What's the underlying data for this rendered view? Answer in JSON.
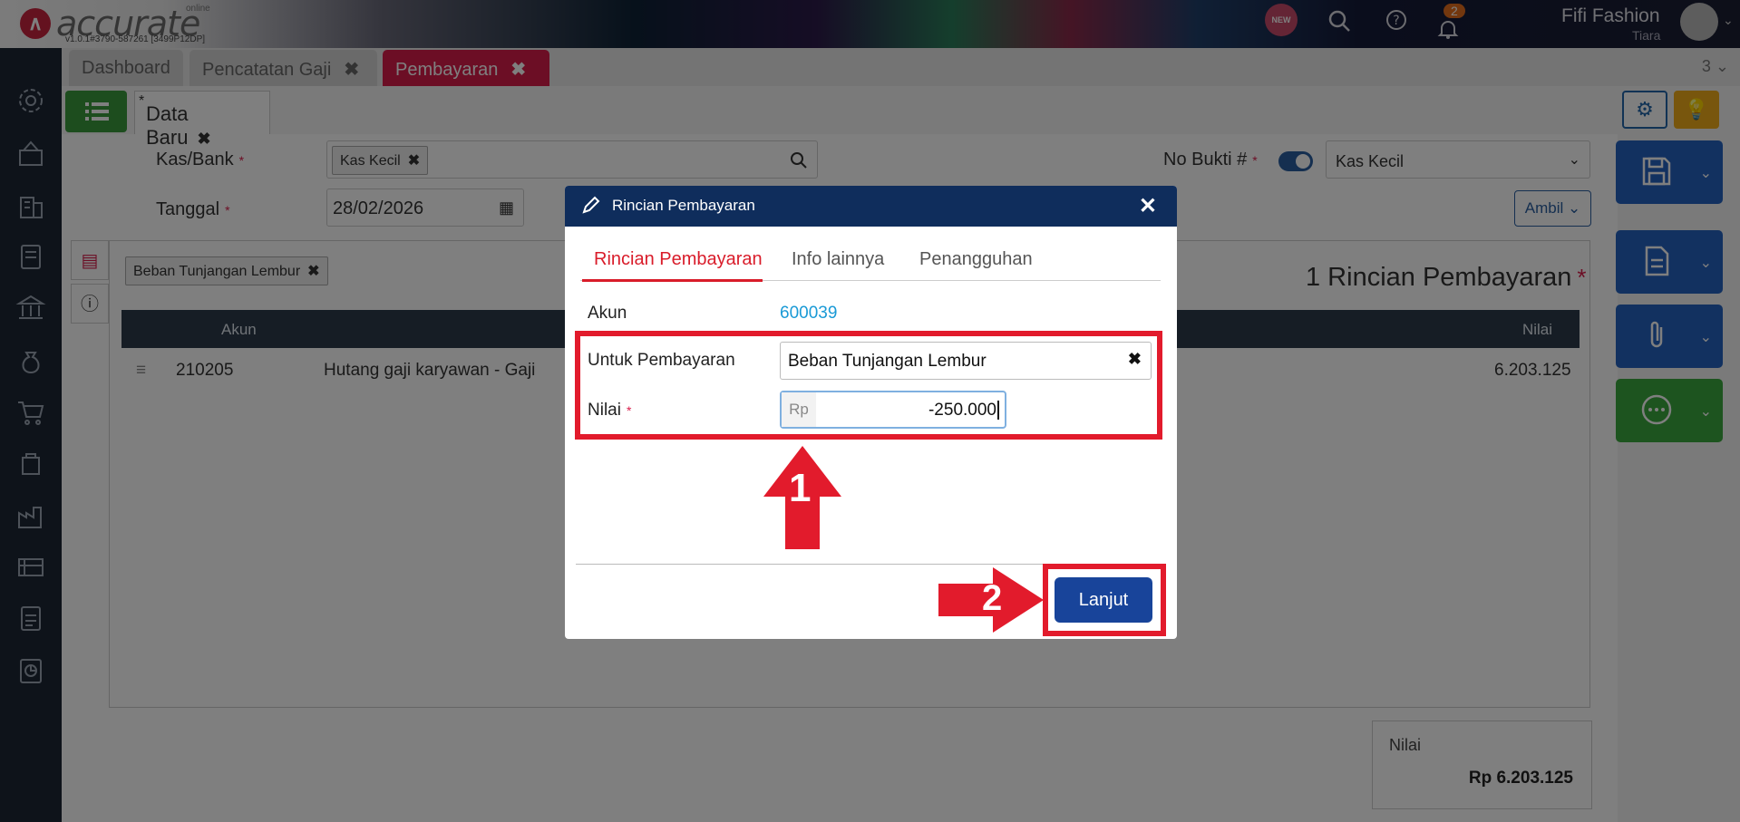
{
  "header": {
    "logo_text": "accurate",
    "logo_sub": "online",
    "version": "v1.0.1#3790-587261 [3499P12DP]",
    "new_badge": "NEW",
    "notification_count": "2",
    "company": "Fifi Fashion",
    "user": "Tiara"
  },
  "module_tabs": [
    {
      "label": "Dashboard"
    },
    {
      "label": "Pencatatan Gaji"
    },
    {
      "label": "Pembayaran"
    }
  ],
  "module_count": "3",
  "subtab": {
    "label": "Data Baru",
    "marker": "*"
  },
  "form": {
    "kas_bank_label": "Kas/Bank",
    "kas_bank_value": "Kas Kecil",
    "tanggal_label": "Tanggal",
    "tanggal_value": "28/02/2026",
    "no_bukti_label": "No Bukti #",
    "no_bukti_value": "Kas Kecil",
    "ambil_label": "Ambil",
    "required_mark": "*"
  },
  "detail": {
    "filter_chip": "Beban Tunjangan Lembur",
    "title": "1 Rincian Pembayaran",
    "columns": [
      "Akun",
      "Nilai"
    ],
    "rows": [
      {
        "akun": "210205",
        "nama": "Hutang gaji karyawan - Gaji",
        "nilai": "6.203.125"
      }
    ]
  },
  "total": {
    "label": "Nilai",
    "value": "Rp 6.203.125"
  },
  "modal": {
    "title": "Rincian Pembayaran",
    "tabs": [
      "Rincian Pembayaran",
      "Info lainnya",
      "Penangguhan"
    ],
    "akun_label": "Akun",
    "akun_value": "600039",
    "untuk_label": "Untuk Pembayaran",
    "untuk_value": "Beban Tunjangan Lembur",
    "nilai_label": "Nilai",
    "nilai_currency": "Rp",
    "nilai_value": "-250.000",
    "lanjut_label": "Lanjut"
  },
  "annotations": {
    "step1": "1",
    "step2": "2"
  },
  "colors": {
    "accent": "#d91c4a",
    "modal_header": "#0f2d5c",
    "primary_button": "#18449a",
    "annotation": "#e21b2c"
  }
}
